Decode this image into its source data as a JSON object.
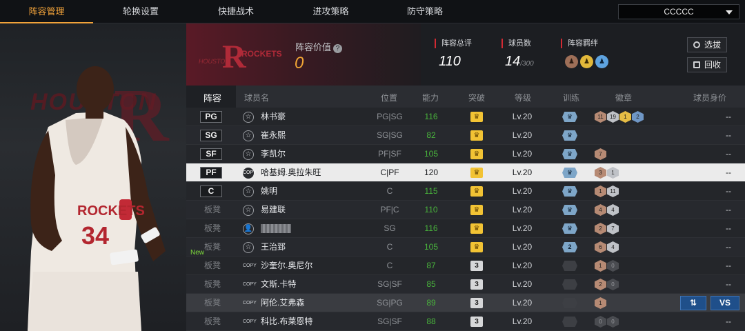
{
  "nav": {
    "tabs": [
      {
        "label": "阵容管理",
        "active": true
      },
      {
        "label": "轮换设置"
      },
      {
        "label": "快捷战术"
      },
      {
        "label": "进攻策略"
      },
      {
        "label": "防守策略"
      }
    ],
    "team_select": "CCCCC"
  },
  "banner": {
    "team_logo_text": "ROCKETS",
    "team_logo_sub": "HOUSTON",
    "lineup_value_label": "阵容价值",
    "lineup_value": "0",
    "overall_label": "阵容总评",
    "overall": "110",
    "players_label": "球员数",
    "players_count": "14",
    "players_max": "/300",
    "synergy_label": "阵容羁绊",
    "btn_select": "选拔",
    "btn_recycle": "回收"
  },
  "left_art": {
    "bg_text": "HOUSTON",
    "bg_letter": "R",
    "jersey_team": "ROCKETS",
    "jersey_number": "34"
  },
  "table": {
    "headers": {
      "lineup": "阵容",
      "name": "球员名",
      "position": "位置",
      "rating": "能力",
      "breakthrough": "突破",
      "level": "等级",
      "training": "训练",
      "badges": "徽章",
      "value": "球员身价"
    },
    "rows": [
      {
        "slot": "PG",
        "type": "star",
        "name": "林书豪",
        "pos": "PG|SG",
        "rating": "116",
        "rating_color": "green",
        "brk": "crown",
        "level": "Lv.20",
        "train": "crown",
        "badges": [
          [
            "bz",
            "11"
          ],
          [
            "sv",
            "19"
          ],
          [
            "gd",
            "1"
          ],
          [
            "hf",
            "2"
          ]
        ],
        "value": "--"
      },
      {
        "slot": "SG",
        "type": "star",
        "name": "崔永熙",
        "pos": "SG|SG",
        "rating": "82",
        "rating_color": "green",
        "brk": "crown",
        "level": "Lv.20",
        "train": "crown",
        "badges": [],
        "value": "--"
      },
      {
        "slot": "SF",
        "type": "star",
        "name": "李凯尔",
        "pos": "PF|SF",
        "rating": "105",
        "rating_color": "green",
        "brk": "crown",
        "level": "Lv.20",
        "train": "crown",
        "badges": [
          [
            "bz",
            "7"
          ]
        ],
        "value": "--"
      },
      {
        "slot": "PF",
        "type": "copy",
        "name": "哈基姆.奥拉朱旺",
        "pos": "C|PF",
        "rating": "120",
        "rating_color": "white",
        "brk": "crown",
        "level": "Lv.20",
        "train": "crown",
        "badges": [
          [
            "bz",
            "3"
          ],
          [
            "sv",
            "1"
          ]
        ],
        "value": "--",
        "selected": true
      },
      {
        "slot": "C",
        "type": "star",
        "name": "姚明",
        "pos": "C",
        "rating": "115",
        "rating_color": "green",
        "brk": "crown",
        "level": "Lv.20",
        "train": "crown",
        "badges": [
          [
            "bz",
            "1"
          ],
          [
            "sv",
            "11"
          ]
        ],
        "value": "--"
      },
      {
        "bench": "板凳",
        "type": "star",
        "name": "易建联",
        "pos": "PF|C",
        "rating": "110",
        "rating_color": "green",
        "brk": "crown",
        "level": "Lv.20",
        "train": "crown",
        "badges": [
          [
            "bz",
            "4"
          ],
          [
            "sv",
            "4"
          ]
        ],
        "value": "--"
      },
      {
        "bench": "板凳",
        "type": "user",
        "name": "",
        "pos": "SG",
        "rating": "116",
        "rating_color": "green",
        "brk": "crown",
        "level": "Lv.20",
        "train": "crown",
        "badges": [
          [
            "bz",
            "2"
          ],
          [
            "sv",
            "7"
          ]
        ],
        "value": "--"
      },
      {
        "bench": "板凳",
        "new": "New",
        "type": "star",
        "name": "王治郅",
        "pos": "C",
        "rating": "105",
        "rating_color": "green",
        "brk": "crown",
        "level": "Lv.20",
        "train": "2",
        "badges": [
          [
            "bz",
            "6"
          ],
          [
            "sv",
            "4"
          ]
        ],
        "value": "--"
      },
      {
        "bench": "板凳",
        "type": "copy",
        "name": "沙奎尔.奥尼尔",
        "pos": "C",
        "rating": "87",
        "rating_color": "green",
        "brk": "3",
        "level": "Lv.20",
        "train": "dark",
        "badges": [
          [
            "bz",
            "1"
          ],
          [
            "dk",
            "0"
          ]
        ],
        "value": "--"
      },
      {
        "bench": "板凳",
        "type": "copy",
        "name": "文斯.卡特",
        "pos": "SG|SF",
        "rating": "85",
        "rating_color": "green",
        "brk": "3",
        "level": "Lv.20",
        "train": "dark",
        "badges": [
          [
            "bz",
            "2"
          ],
          [
            "dk",
            "0"
          ]
        ],
        "value": "--"
      },
      {
        "bench": "板凳",
        "type": "copy",
        "name": "阿伦.艾弗森",
        "pos": "SG|PG",
        "rating": "89",
        "rating_color": "green",
        "brk": "3",
        "level": "Lv.20",
        "train": "dark",
        "badges": [
          [
            "bz",
            "1"
          ]
        ],
        "value": "",
        "hover": true,
        "swap_label": "⇅",
        "vs_label": "VS"
      },
      {
        "bench": "板凳",
        "type": "copy",
        "name": "科比.布莱恩特",
        "pos": "SG|SF",
        "rating": "88",
        "rating_color": "green",
        "brk": "3",
        "level": "Lv.20",
        "train": "dark",
        "badges": [
          [
            "dk",
            "0"
          ],
          [
            "dk",
            "0"
          ]
        ],
        "value": "--"
      }
    ]
  },
  "colors": {
    "accent": "#f2a33a",
    "green": "#49b43c",
    "team_red": "#5a1a26"
  }
}
